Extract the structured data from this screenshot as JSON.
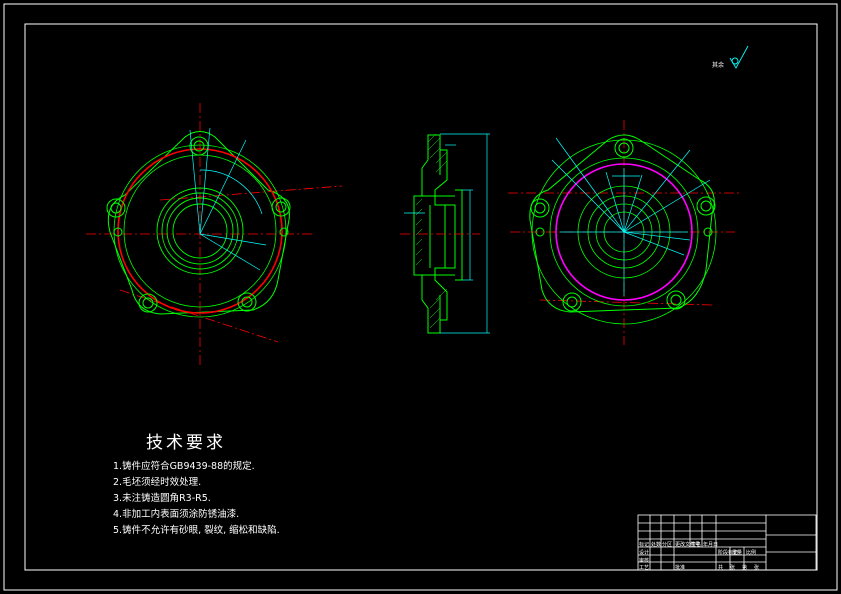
{
  "drawing": {
    "sheet_color": "#000000",
    "frame_color": "#ffffff",
    "part_color": "#00ff00",
    "center_line_color": "#ff0000",
    "dimension_color": "#00ffff",
    "hidden_color": "#ff00ff"
  },
  "roughness_note": {
    "label": "其余",
    "symbol": "roughness-symbol-icon"
  },
  "technical_requirements": {
    "title": "技术要求",
    "items": [
      "1.铸件应符合GB9439-88的规定.",
      "2.毛坯须经时效处理.",
      "3.未注铸造圆角R3-R5.",
      "4.非加工内表面须涂防锈油漆.",
      "5.铸件不允许有砂眼, 裂纹, 缩松和缺陷."
    ]
  },
  "title_block": {
    "cells": [
      "标记",
      "处数",
      "分区",
      "更改文件号",
      "签名",
      "年月日",
      "设计",
      "审核",
      "工艺",
      "批准",
      "阶段标记",
      "重量",
      "比例",
      "共",
      "张",
      "第",
      "张"
    ]
  }
}
